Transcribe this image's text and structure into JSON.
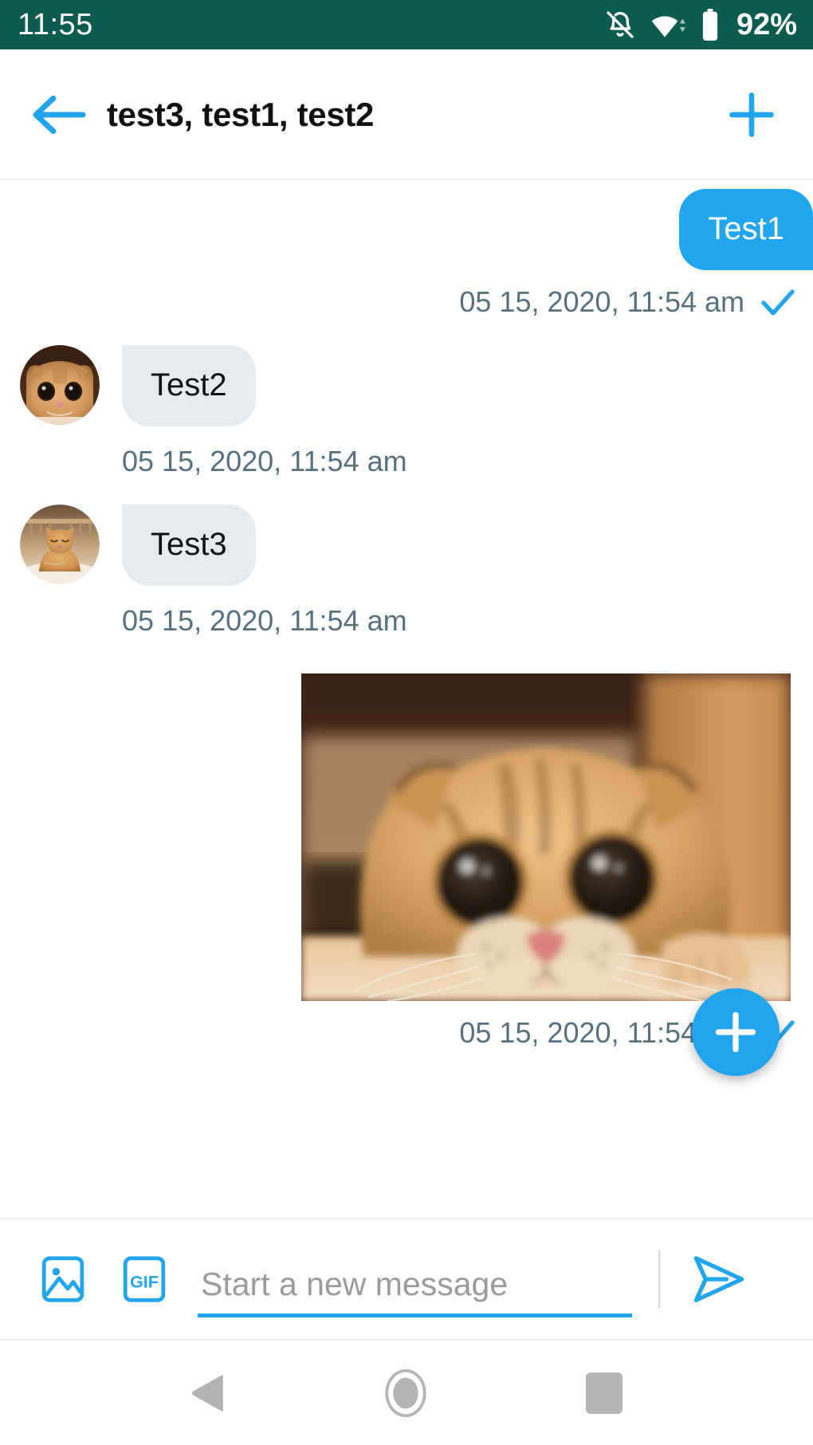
{
  "status_bar": {
    "time": "11:55",
    "battery_percent": "92%",
    "icons": [
      "bell-off-icon",
      "wifi-icon",
      "battery-icon"
    ],
    "background_color": "#0b5c4f"
  },
  "header": {
    "back_icon": "arrow-left-icon",
    "title": "test3, test1, test2",
    "add_icon": "plus-icon",
    "accent_color": "#22a5ef"
  },
  "conversation": {
    "messages": [
      {
        "id": "msg-1",
        "direction": "outgoing",
        "type": "text",
        "text": "Test1",
        "timestamp": "05 15, 2020, 11:54 am",
        "status_icon": "check-icon",
        "bubble_color": "#22a5ef",
        "text_color": "#ffffff"
      },
      {
        "id": "msg-2",
        "direction": "incoming",
        "type": "text",
        "text": "Test2",
        "timestamp": "05 15, 2020, 11:54 am",
        "avatar": "cat-peeking-avatar",
        "bubble_color": "#e6ebef",
        "text_color": "#111111"
      },
      {
        "id": "msg-3",
        "direction": "incoming",
        "type": "text",
        "text": "Test3",
        "timestamp": "05 15, 2020, 11:54 am",
        "avatar": "cat-lying-avatar",
        "bubble_color": "#e6ebef",
        "text_color": "#111111"
      },
      {
        "id": "msg-4",
        "direction": "outgoing",
        "type": "image",
        "image_alt": "scottish-fold-cat-photo",
        "timestamp": "05 15, 2020, 11:54 am",
        "status_icon": "check-icon"
      }
    ],
    "timestamp_color": "#57707f"
  },
  "fab": {
    "icon": "plus-icon",
    "color": "#22a5ef"
  },
  "input_bar": {
    "image_icon": "image-picker-icon",
    "gif_icon": "gif-icon",
    "gif_label": "GIF",
    "placeholder": "Start a new message",
    "value": "",
    "send_icon": "send-icon",
    "accent_color": "#22a5ef"
  },
  "nav_bar": {
    "back_icon": "nav-back-triangle-icon",
    "home_icon": "nav-home-circle-icon",
    "recents_icon": "nav-recents-square-icon",
    "color": "#b4b4b4"
  }
}
